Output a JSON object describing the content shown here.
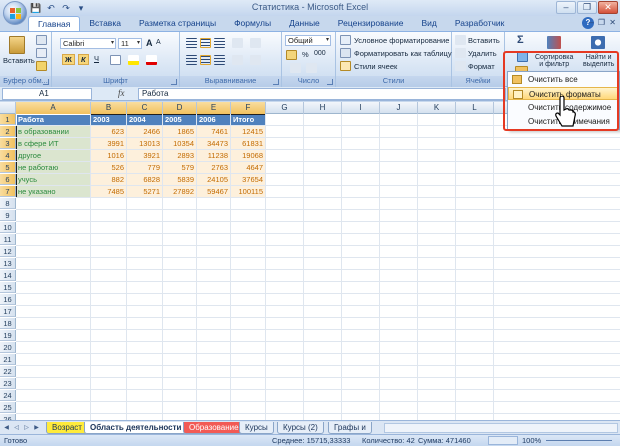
{
  "window": {
    "title": "Статистика - Microsoft Excel"
  },
  "ribbon_tabs": [
    "Главная",
    "Вставка",
    "Разметка страницы",
    "Формулы",
    "Данные",
    "Рецензирование",
    "Вид",
    "Разработчик"
  ],
  "ribbon": {
    "clipboard": {
      "paste": "Вставить",
      "label": "Буфер обм..."
    },
    "font": {
      "name": "Calibri",
      "size": "11",
      "bold": "Ж",
      "italic": "К",
      "underline": "Ч",
      "grow": "A",
      "shrink": "A",
      "label": "Шрифт"
    },
    "alignment": {
      "label": "Выравнивание"
    },
    "number": {
      "format": "Общий",
      "percent": "%",
      "thousands": "000",
      "label": "Число"
    },
    "styles": {
      "conditional": "Условное форматирование",
      "as_table": "Форматировать как таблицу",
      "cell_styles": "Стили ячеек",
      "label": "Стили"
    },
    "cells": {
      "insert": "Вставить",
      "delete": "Удалить",
      "format": "Формат",
      "label": "Ячейки"
    },
    "editing": {
      "sum": "Σ",
      "sort_line1": "Сортировка",
      "sort_line2": "и фильтр",
      "find_line1": "Найти и",
      "find_line2": "выделить"
    }
  },
  "formula_bar": {
    "name_box": "A1",
    "fx": "fx",
    "formula": "Работа"
  },
  "columns": [
    "A",
    "B",
    "C",
    "D",
    "E",
    "F",
    "G",
    "H",
    "I",
    "J",
    "K",
    "L"
  ],
  "rows": [
    "1",
    "2",
    "3",
    "4",
    "5",
    "6",
    "7",
    "8",
    "9",
    "10",
    "11",
    "12",
    "13",
    "14",
    "15",
    "16",
    "17",
    "18",
    "19",
    "20",
    "21",
    "22",
    "23",
    "24",
    "25",
    "26"
  ],
  "table": {
    "header": [
      "Работа",
      "2003",
      "2004",
      "2005",
      "2006",
      "Итого"
    ],
    "rows": [
      [
        "в образовании",
        "623",
        "2466",
        "1865",
        "7461",
        "12415"
      ],
      [
        "в сфере ИТ",
        "3991",
        "13013",
        "10354",
        "34473",
        "61831"
      ],
      [
        "другое",
        "1016",
        "3921",
        "2893",
        "11238",
        "19068"
      ],
      [
        "не работаю",
        "526",
        "779",
        "579",
        "2763",
        "4647"
      ],
      [
        "учусь",
        "882",
        "6828",
        "5839",
        "24105",
        "37654"
      ],
      [
        "не указано",
        "7485",
        "5271",
        "27892",
        "59467",
        "100115"
      ]
    ]
  },
  "sheet_tabs": [
    "Возраст",
    "Область деятельности",
    "Образование",
    "Курсы",
    "Курсы (2)",
    "Графы и"
  ],
  "active_sheet": "Область деятельности",
  "status": {
    "ready": "Готово",
    "average": "Среднее: 15715,33333",
    "count": "Количество: 42",
    "sum": "Сумма: 471460",
    "zoom": "100%"
  },
  "clear_menu": {
    "items": [
      "Очистить все",
      "Очистить форматы",
      "Очистить содержимое",
      "Очистить примечания"
    ],
    "highlighted": "Очистить форматы"
  },
  "colors": {
    "header_fill": "#4f81bd",
    "name_fill": "#dbe5cf",
    "name_text": "#2b8a3e",
    "value_fill": "#fdf0dc",
    "value_text": "#c36b00",
    "highlight": "#e53922"
  }
}
